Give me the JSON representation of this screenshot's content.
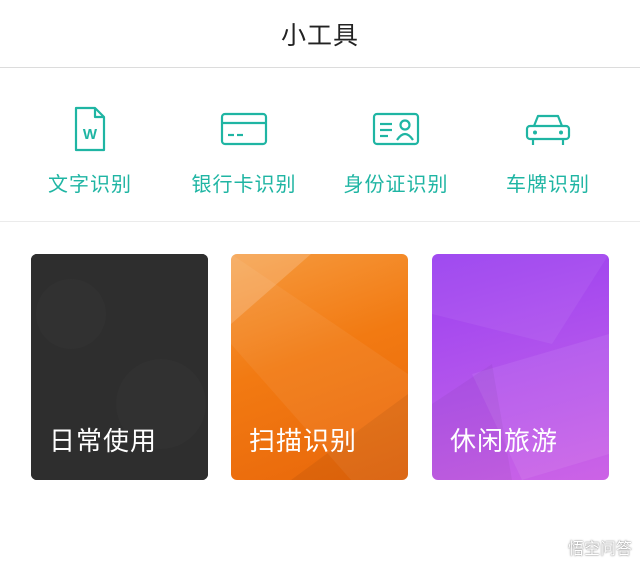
{
  "header": {
    "title": "小工具"
  },
  "tools": [
    {
      "label": "文字识别",
      "icon": "document-w-icon"
    },
    {
      "label": "银行卡识别",
      "icon": "bank-card-icon"
    },
    {
      "label": "身份证识别",
      "icon": "id-card-icon"
    },
    {
      "label": "车牌识别",
      "icon": "car-icon"
    }
  ],
  "cards": [
    {
      "label": "日常使用",
      "color": "#2b2b2b"
    },
    {
      "label": "扫描识别",
      "color": "#f27a12"
    },
    {
      "label": "休闲旅游",
      "color": "#b456ec"
    }
  ],
  "colors": {
    "accent": "#1fb5a3"
  },
  "watermark": {
    "text": "悟空问答"
  }
}
